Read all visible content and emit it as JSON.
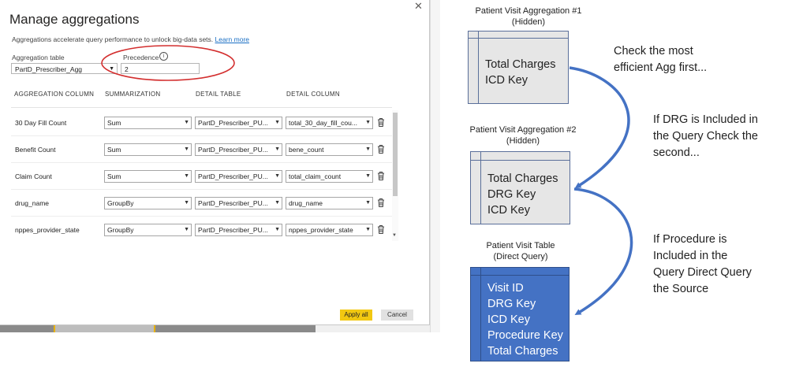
{
  "dialog": {
    "title": "Manage aggregations",
    "close_glyph": "✕",
    "description": "Aggregations accelerate query performance to unlock big-data sets.",
    "learn_more": "Learn more",
    "aggregation_table_label": "Aggregation table",
    "aggregation_table_value": "PartD_Prescriber_Agg",
    "precedence_label": "Precedence",
    "precedence_value": "2",
    "columns": [
      "AGGREGATION COLUMN",
      "SUMMARIZATION",
      "DETAIL TABLE",
      "DETAIL COLUMN"
    ],
    "rows": [
      {
        "column": "30 Day Fill Count",
        "summarization": "Sum",
        "detail_table": "PartD_Prescriber_PU...",
        "detail_column": "total_30_day_fill_cou..."
      },
      {
        "column": "Benefit Count",
        "summarization": "Sum",
        "detail_table": "PartD_Prescriber_PU...",
        "detail_column": "bene_count"
      },
      {
        "column": "Claim Count",
        "summarization": "Sum",
        "detail_table": "PartD_Prescriber_PU...",
        "detail_column": "total_claim_count"
      },
      {
        "column": "drug_name",
        "summarization": "GroupBy",
        "detail_table": "PartD_Prescriber_PU...",
        "detail_column": "drug_name"
      },
      {
        "column": "nppes_provider_state",
        "summarization": "GroupBy",
        "detail_table": "PartD_Prescriber_PU...",
        "detail_column": "nppes_provider_state"
      }
    ],
    "apply_label": "Apply all",
    "cancel_label": "Cancel"
  },
  "diagram": {
    "agg1": {
      "title_line1": "Patient Visit Aggregation #1",
      "title_line2": "(Hidden)",
      "fields": [
        "Total Charges",
        "ICD Key"
      ]
    },
    "agg2": {
      "title_line1": "Patient Visit Aggregation #2",
      "title_line2": "(Hidden)",
      "fields": [
        "Total Charges",
        "DRG Key",
        "ICD Key"
      ]
    },
    "table": {
      "title_line1": "Patient Visit Table",
      "title_line2": "(Direct Query)",
      "fields": [
        "Visit ID",
        "DRG Key",
        "ICD Key",
        "Procedure Key",
        "Total Charges"
      ]
    },
    "note1": [
      "Check the most",
      "efficient Agg first..."
    ],
    "note2": [
      "If DRG is Included in",
      "the Query Check the",
      "second..."
    ],
    "note3": [
      "If Procedure is",
      "Included in the",
      "Query Direct Query",
      "the Source"
    ]
  },
  "colors": {
    "apply": "#f2c811",
    "highlight": "#d32f2f",
    "arrow": "#4472c4",
    "table_fill": "#4472c4",
    "agg_fill": "#e6e6e6"
  }
}
